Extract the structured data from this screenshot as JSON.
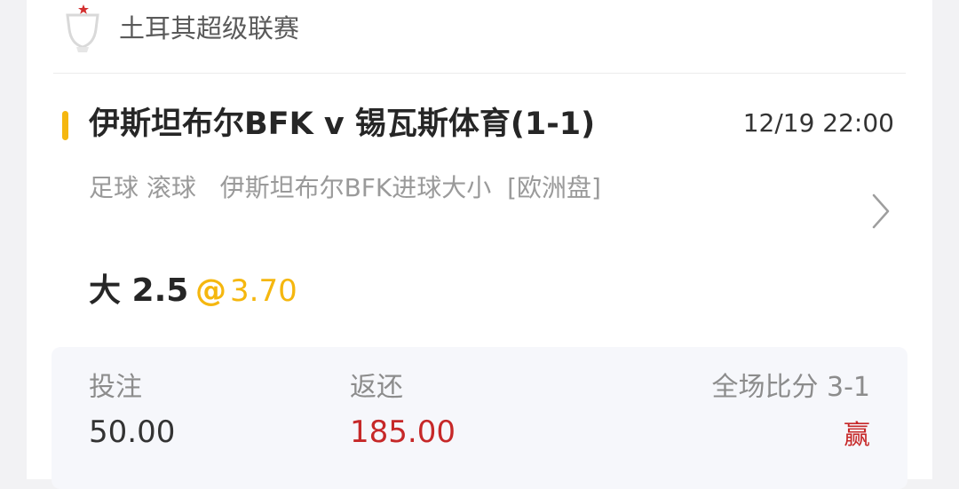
{
  "league": {
    "name": "土耳其超级联赛",
    "icon": "trophy-icon"
  },
  "match": {
    "title": "伊斯坦布尔BFK v 锡瓦斯体育(1-1)",
    "datetime": "12/19 22:00"
  },
  "bet": {
    "description": "足球 滚球   伊斯坦布尔BFK进球大小  [欧洲盘]",
    "selection": "大 2.5",
    "odds_prefix": "@",
    "odds": "3.70"
  },
  "summary": {
    "stake_label": "投注",
    "stake_value": "50.00",
    "return_label": "返还",
    "return_value": "185.00",
    "score_label": "全场比分 3-1",
    "result": "赢"
  },
  "colors": {
    "accent": "#f5b70f",
    "win": "#c62828",
    "background": "#f2f2f4"
  }
}
